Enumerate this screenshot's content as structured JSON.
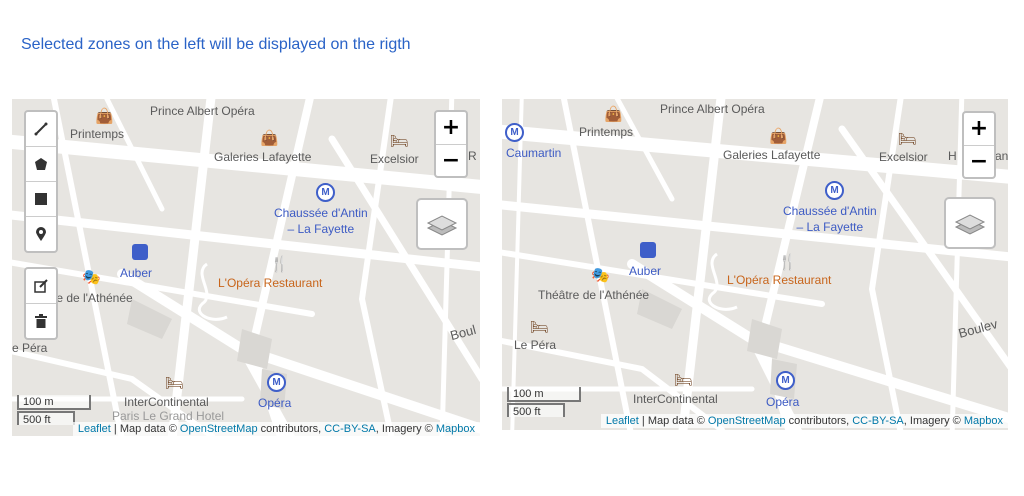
{
  "heading": "Selected zones on the left will be displayed on the rigth",
  "colors": {
    "map_bg": "#e7e5e1",
    "road": "#ffffff",
    "metro_blue": "#3f5fc9",
    "link": "#0078a8",
    "heading": "#2a63c7"
  },
  "left_map": {
    "zoom_in": "+",
    "zoom_out": "−",
    "scale_top": "100 m",
    "scale_bottom": "500 ft",
    "draw_tools": [
      "polyline-icon",
      "polygon-icon",
      "rectangle-icon",
      "marker-icon"
    ],
    "edit_tools": [
      "edit-icon",
      "trash-icon"
    ],
    "labels": {
      "prince_albert": "Prince Albert Opéra",
      "printemps": "Printemps",
      "galeries": "Galeries Lafayette",
      "excelsior": "Excelsior",
      "chaussee": "Chaussée d'Antin",
      "chaussee2": "– La Fayette",
      "auber": "Auber",
      "athenee": "tre de l'Athénée",
      "opera_restaurant": "L'Opéra Restaurant",
      "le_pera": "e Péra",
      "intercontinental": "InterContinental",
      "opera": "Opéra",
      "paris_grand": "Paris Le Grand Hotel",
      "boul": "Boul",
      "r_edge": "R E"
    },
    "attribution": {
      "leaflet": "Leaflet",
      "sep": " | Map data © ",
      "osm": "OpenStreetMap",
      "contrib": " contributors, ",
      "license": "CC-BY-SA",
      "imagery": ", Imagery © ",
      "mapbox": "Mapbox"
    }
  },
  "right_map": {
    "zoom_in": "+",
    "zoom_out": "−",
    "scale_top": "100 m",
    "scale_bottom": "500 ft",
    "labels": {
      "prince_albert": "Prince Albert Opéra",
      "printemps": "Printemps",
      "caumartin": "Caumartin",
      "galeries": "Galeries Lafayette",
      "excelsior": "Excelsior",
      "h_edge": "H",
      "an_edge": "an",
      "chaussee": "Chaussée d'Antin",
      "chaussee2": "– La Fayette",
      "auber": "Auber",
      "athenee": "Théâtre de l'Athénée",
      "opera_restaurant": "L'Opéra Restaurant",
      "le_pera": "Le Péra",
      "intercontinental": "InterContinental",
      "opera": "Opéra",
      "boulev": "Boulev"
    },
    "attribution": {
      "leaflet": "Leaflet",
      "sep": " | Map data © ",
      "osm": "OpenStreetMap",
      "contrib": " contributors, ",
      "license": "CC-BY-SA",
      "imagery": ", Imagery © ",
      "mapbox": "Mapbox"
    }
  }
}
